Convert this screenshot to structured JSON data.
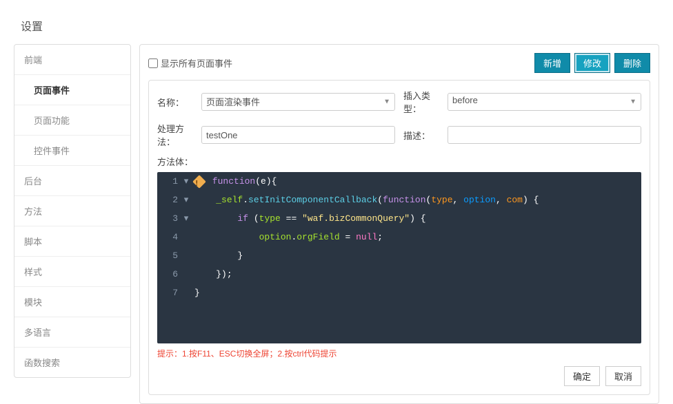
{
  "pageTitle": "设置",
  "sidebar": {
    "items": [
      {
        "label": "前端"
      },
      {
        "label": "页面事件"
      },
      {
        "label": "页面功能"
      },
      {
        "label": "控件事件"
      },
      {
        "label": "后台"
      },
      {
        "label": "方法"
      },
      {
        "label": "脚本"
      },
      {
        "label": "样式"
      },
      {
        "label": "模块"
      },
      {
        "label": "多语言"
      },
      {
        "label": "函数搜索"
      }
    ]
  },
  "topbar": {
    "showAllLabel": "显示所有页面事件",
    "buttons": {
      "add": "新增",
      "edit": "修改",
      "delete": "删除"
    }
  },
  "form": {
    "nameLabel": "名称：",
    "nameValue": "页面渲染事件",
    "insertTypeLabel": "插入类型：",
    "insertTypeValue": "before",
    "handlerLabel": "处理方法：",
    "handlerValue": "testOne",
    "descLabel": "描述：",
    "descValue": "",
    "bodyLabel": "方法体："
  },
  "code": {
    "l1_kw": "function",
    "l1_paren": "(e){",
    "l2_obj": "_self",
    "l2_dot": ".",
    "l2_method": "setInitComponentCallback",
    "l2_open": "(",
    "l2_fn": "function",
    "l2_args_open": "(",
    "l2_a1": "type",
    "l2_a2": "option",
    "l2_a3": "com",
    "l2_args_close": ") {",
    "l3_if": "if",
    "l3_open": " (",
    "l3_var": "type",
    "l3_eq": " == ",
    "l3_str": "\"waf.bizCommonQuery\"",
    "l3_close": ") {",
    "l4_obj": "option",
    "l4_dot": ".",
    "l4_prop": "orgField",
    "l4_eq": " = ",
    "l4_null": "null",
    "l4_semi": ";",
    "l5": "}",
    "l6": "});",
    "l7": "}"
  },
  "hint": "提示：1.按F11、ESC切换全屏；2.按ctrl代码提示",
  "footer": {
    "ok": "确定",
    "cancel": "取消"
  }
}
